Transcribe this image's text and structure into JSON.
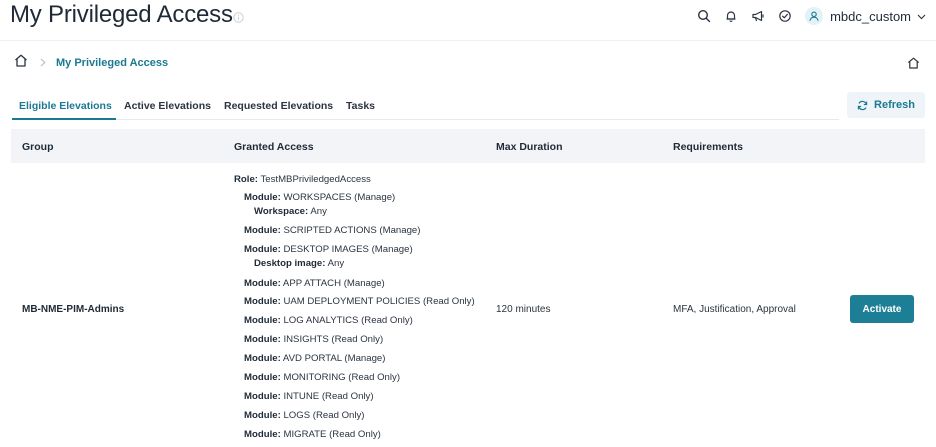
{
  "header": {
    "title": "My Privileged Access",
    "username": "mbdc_custom"
  },
  "breadcrumb": {
    "current": "My Privileged Access"
  },
  "tabs": [
    {
      "label": "Eligible Elevations",
      "active": true
    },
    {
      "label": "Active Elevations",
      "active": false
    },
    {
      "label": "Requested Elevations",
      "active": false
    },
    {
      "label": "Tasks",
      "active": false
    }
  ],
  "refresh_label": "Refresh",
  "table": {
    "headers": [
      "Group",
      "Granted Access",
      "Max Duration",
      "Requirements"
    ],
    "row": {
      "group": "MB-NME-PIM-Admins",
      "max_duration": "120 minutes",
      "requirements": "MFA, Justification, Approval",
      "action_label": "Activate",
      "access": [
        {
          "label": "Role:",
          "value": " TestMBPriviledgedAccess"
        },
        {
          "label": "Module:",
          "value": " WORKSPACES (Manage)"
        },
        {
          "label": "Workspace:",
          "value": " Any"
        },
        {
          "label": "Module:",
          "value": " SCRIPTED ACTIONS (Manage)"
        },
        {
          "label": "Module:",
          "value": " DESKTOP IMAGES (Manage)"
        },
        {
          "label": "Desktop image:",
          "value": " Any"
        },
        {
          "label": "Module:",
          "value": " APP ATTACH (Manage)"
        },
        {
          "label": "Module:",
          "value": " UAM DEPLOYMENT POLICIES (Read Only)"
        },
        {
          "label": "Module:",
          "value": " LOG ANALYTICS (Read Only)"
        },
        {
          "label": "Module:",
          "value": " INSIGHTS (Read Only)"
        },
        {
          "label": "Module:",
          "value": " AVD PORTAL (Manage)"
        },
        {
          "label": "Module:",
          "value": " MONITORING (Read Only)"
        },
        {
          "label": "Module:",
          "value": " INTUNE (Read Only)"
        },
        {
          "label": "Module:",
          "value": " LOGS (Read Only)"
        },
        {
          "label": "Module:",
          "value": " MIGRATE (Read Only)"
        }
      ]
    }
  },
  "colors": {
    "accent": "#1a7a91",
    "button": "#1d7f95",
    "header_bg": "#f2f4f7"
  }
}
